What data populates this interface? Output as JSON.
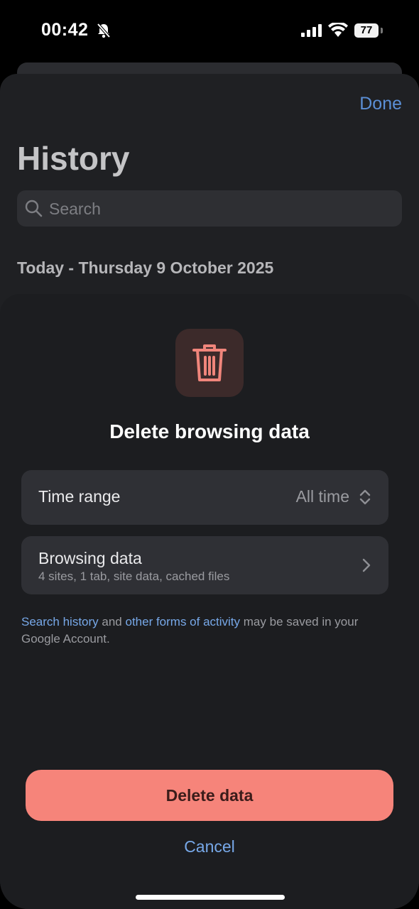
{
  "status_bar": {
    "time": "00:42",
    "battery": "77",
    "icons": [
      "bell-muted-icon",
      "signal-icon",
      "wifi-icon",
      "battery-icon"
    ]
  },
  "history": {
    "done_label": "Done",
    "title": "History",
    "search_placeholder": "Search",
    "date_header": "Today - Thursday 9 October 2025"
  },
  "delete_sheet": {
    "icon": "trash-icon",
    "title": "Delete browsing data",
    "time_range": {
      "label": "Time range",
      "value": "All time"
    },
    "browsing_data": {
      "label": "Browsing data",
      "summary": "4 sites, 1 tab, site data, cached files"
    },
    "footnote": {
      "link1": "Search history",
      "text1": " and ",
      "link2": "other forms of activity",
      "text2": " may be saved in your Google Account."
    },
    "delete_label": "Delete data",
    "cancel_label": "Cancel"
  },
  "colors": {
    "accent_link": "#77a8e8",
    "done_blue": "#5b8fd6",
    "delete_button": "#f6847a",
    "trash_icon": "#f0857b"
  }
}
